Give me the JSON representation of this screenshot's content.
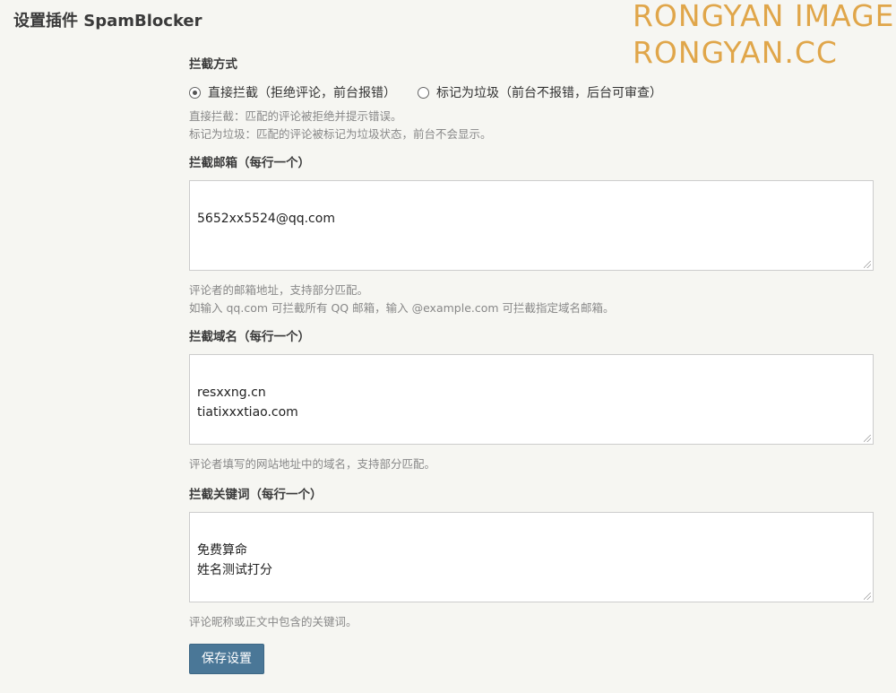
{
  "page": {
    "title": "设置插件 SpamBlocker",
    "watermark_line1": "RONGYAN IMAGE",
    "watermark_line2": "RONGYAN.CC"
  },
  "block_mode": {
    "label": "拦截方式",
    "options": [
      {
        "label": "直接拦截（拒绝评论，前台报错）",
        "checked": true
      },
      {
        "label": "标记为垃圾（前台不报错，后台可审查）",
        "checked": false
      }
    ],
    "help_lines": [
      "直接拦截：匹配的评论被拒绝并提示错误。",
      "标记为垃圾：匹配的评论被标记为垃圾状态，前台不会显示。"
    ]
  },
  "block_emails": {
    "label": "拦截邮箱（每行一个）",
    "value": "5652xx5524@qq.com",
    "help_lines": [
      "评论者的邮箱地址，支持部分匹配。",
      "如输入 qq.com 可拦截所有 QQ 邮箱，输入 @example.com 可拦截指定域名邮箱。"
    ]
  },
  "block_domains": {
    "label": "拦截域名（每行一个）",
    "value": "resxxng.cn\ntiatixxxtiao.com",
    "help_lines": [
      "评论者填写的网站地址中的域名，支持部分匹配。"
    ]
  },
  "block_keywords": {
    "label": "拦截关键词（每行一个）",
    "value": "免费算命\n姓名测试打分",
    "help_lines": [
      "评论昵称或正文中包含的关键词。"
    ]
  },
  "save_button": {
    "label": "保存设置"
  },
  "colors": {
    "background": "#f6f6f2",
    "watermark": "#e0a64a",
    "button": "#4a7797"
  }
}
